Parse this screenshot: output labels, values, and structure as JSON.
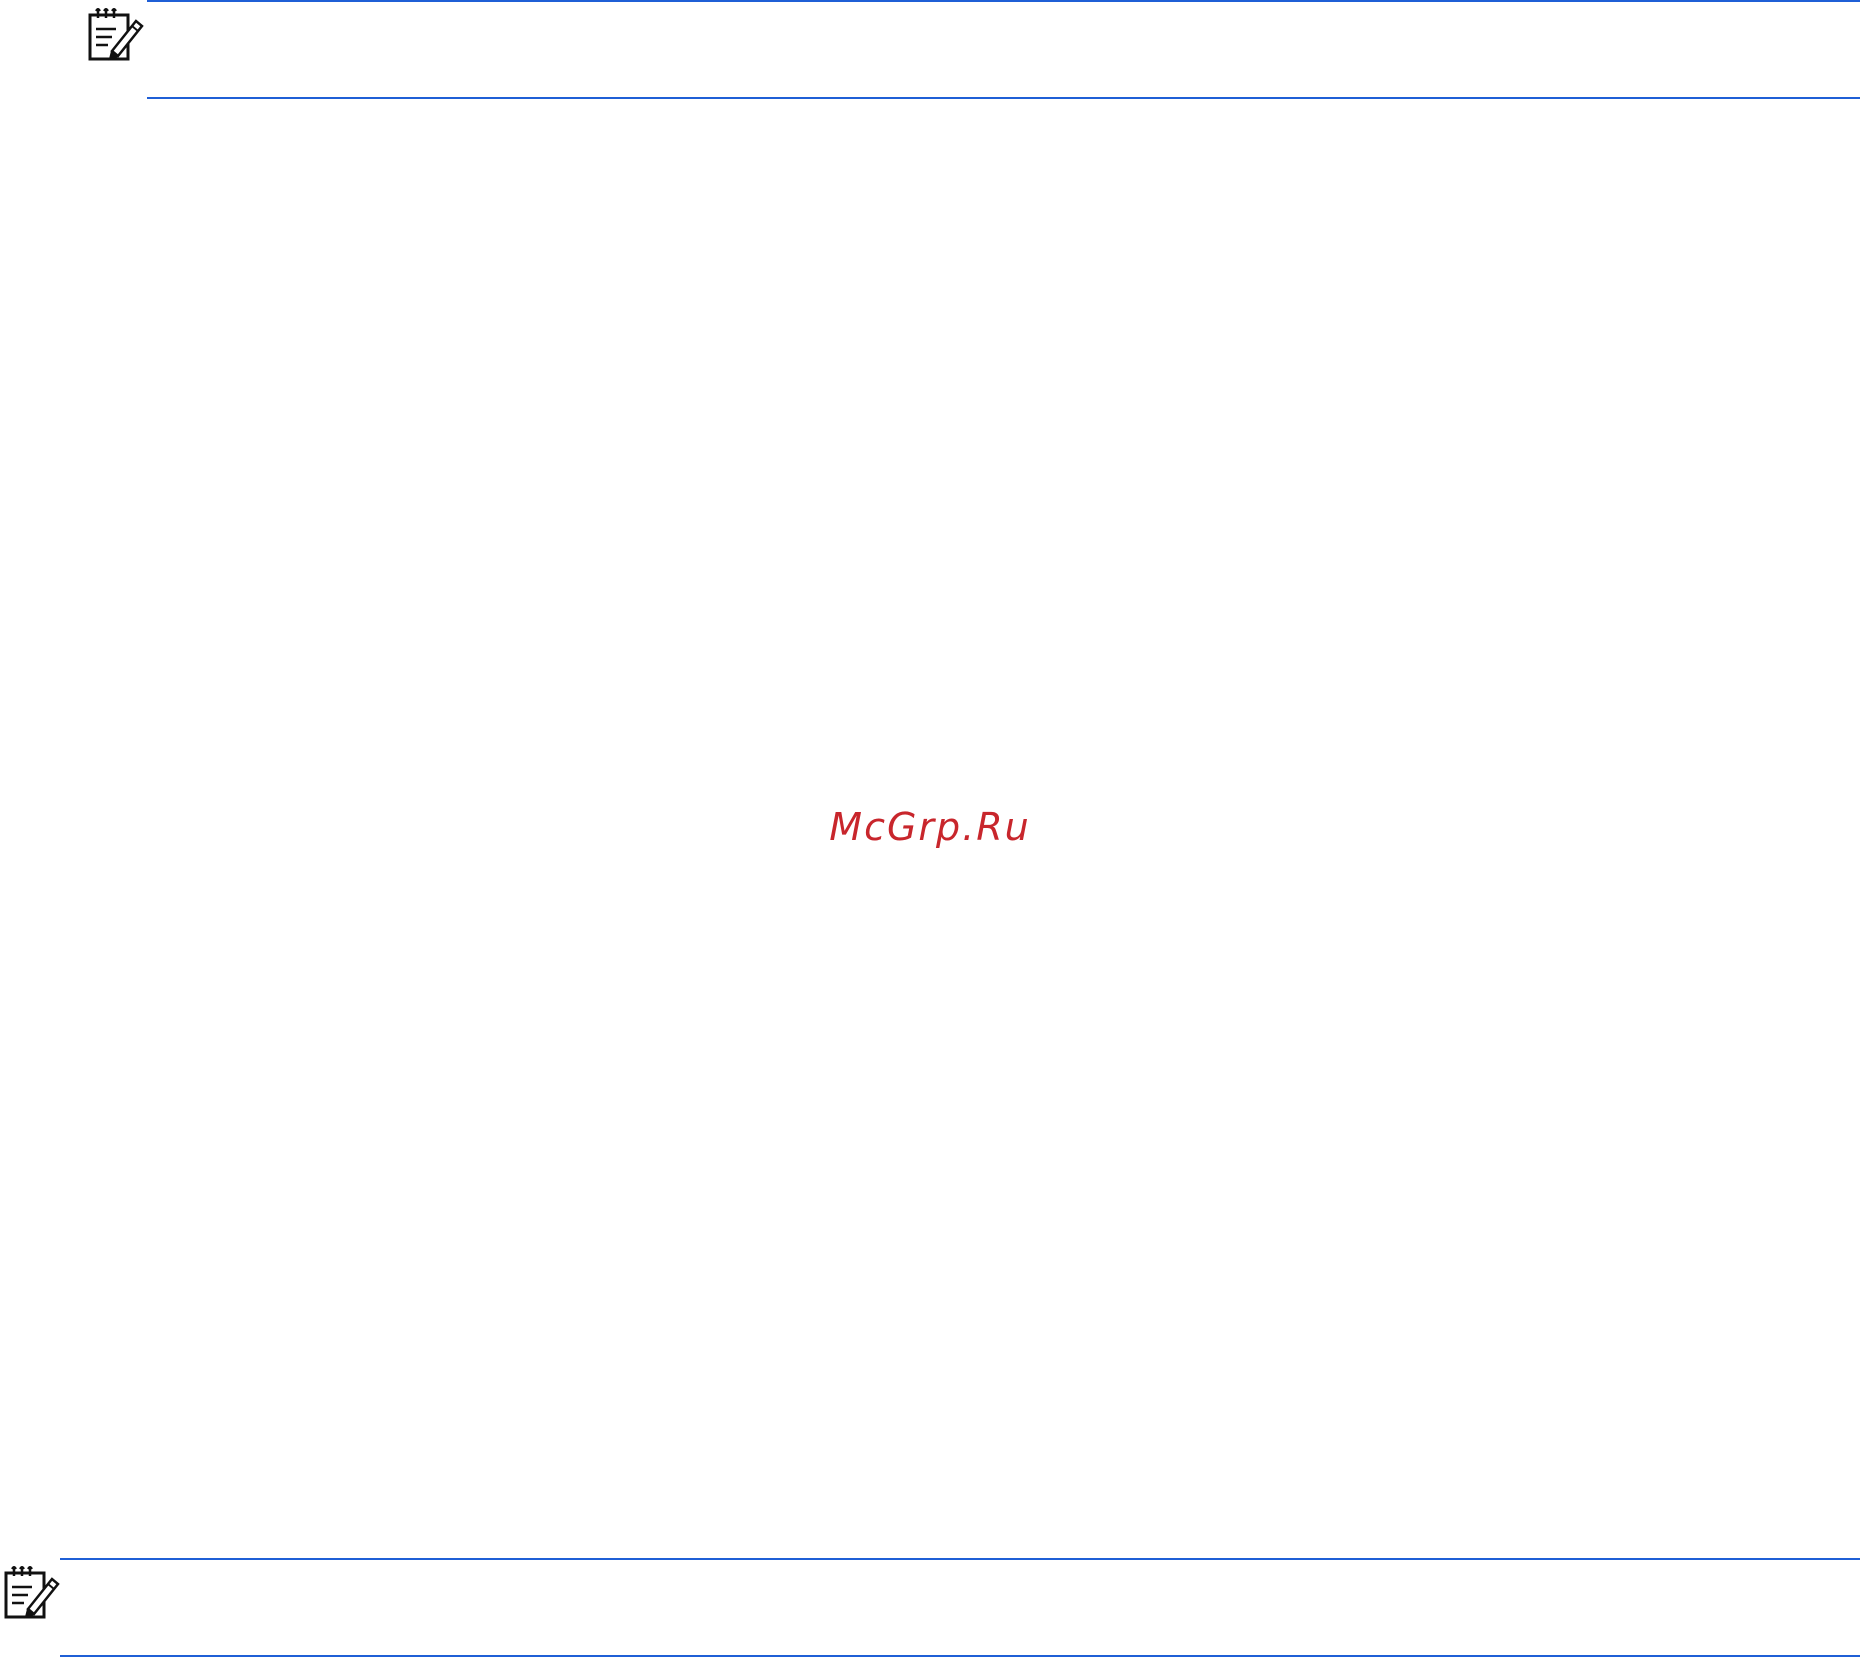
{
  "watermark": {
    "text": "McGrp.Ru",
    "color": "#c8262c"
  },
  "note_blocks": [
    {
      "icon": "note-pencil-icon",
      "rule_color": "#1f5fd6"
    },
    {
      "icon": "note-pencil-icon",
      "rule_color": "#1f5fd6"
    }
  ]
}
